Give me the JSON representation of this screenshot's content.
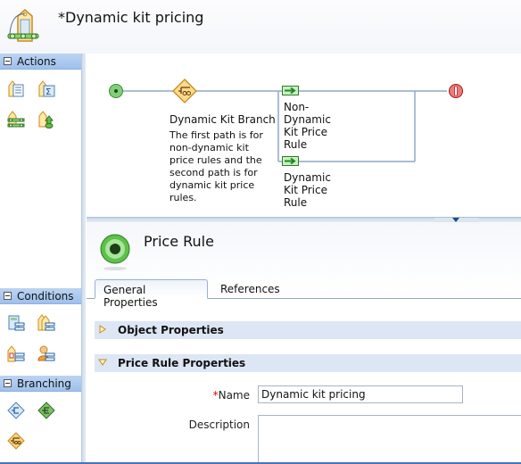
{
  "header": {
    "title": "*Dynamic kit pricing",
    "icon": "price-rule-tag-icon"
  },
  "palette": {
    "drawers": [
      {
        "label": "Actions",
        "tools": [
          "action-list-icon",
          "action-sum-icon",
          "action-kit-icon",
          "action-upload-icon"
        ]
      },
      {
        "label": "Conditions",
        "tools": [
          "condition-catalog-icon",
          "condition-tags-icon",
          "condition-list-icon",
          "condition-customer-icon"
        ]
      },
      {
        "label": "Branching",
        "tools": [
          "branch-blue-icon",
          "branch-green-icon",
          "branch-kit-icon"
        ]
      }
    ]
  },
  "canvas": {
    "start_node": "start-node-icon",
    "branch": {
      "label": "Dynamic Kit Branch",
      "description": [
        "The first path is for",
        "non-dynamic kit",
        "price rules and the",
        "second path is for",
        "dynamic kit price",
        "rules."
      ]
    },
    "paths": [
      {
        "label": [
          "Non-",
          "Dynamic",
          "Kit Price",
          "Rule"
        ]
      },
      {
        "label": [
          "Dynamic",
          "Kit Price",
          "Rule"
        ]
      }
    ],
    "end_node": "end-node-icon"
  },
  "properties": {
    "title": "Price Rule",
    "tabs": [
      {
        "label": "General Properties",
        "active": true
      },
      {
        "label": "References",
        "active": false
      }
    ],
    "sections": [
      {
        "label": "Object Properties",
        "expanded": false
      },
      {
        "label": "Price Rule Properties",
        "expanded": true
      }
    ],
    "fields": {
      "name_required_mark": "*",
      "name_label": "Name",
      "name_value": "Dynamic kit pricing",
      "description_label": "Description",
      "description_value": ""
    }
  },
  "colors": {
    "drawer_header": "#a9c8ef",
    "section_header": "#dde6f4",
    "connector": "#8fa7c6",
    "start_green": "#4caf50",
    "end_red": "#e0303a",
    "branch_orange": "#e8a93a"
  }
}
